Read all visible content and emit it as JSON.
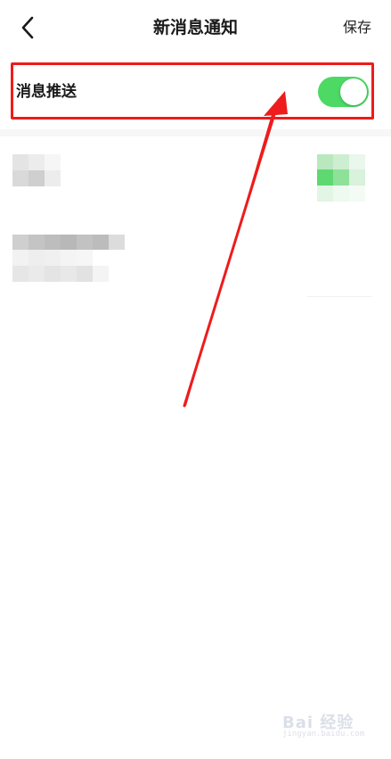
{
  "header": {
    "title": "新消息通知",
    "save_label": "保存",
    "back_icon": "chevron-left-icon"
  },
  "push_row": {
    "label": "消息推送",
    "toggle_on": true
  },
  "colors": {
    "toggle_on": "#4cd964",
    "annotation_red": "#ee1c1c",
    "background": "#ffffff",
    "text": "#1a1a1a"
  },
  "watermark": {
    "logo_text": "Bai 经验",
    "url": "jingyan.baidu.com"
  }
}
